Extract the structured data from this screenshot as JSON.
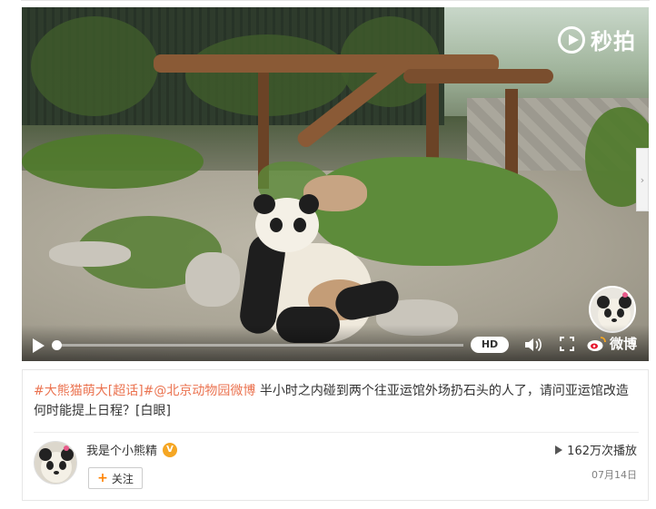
{
  "video": {
    "watermark_top": "秒拍",
    "hd_label": "HD",
    "watermark_bottom": "微博",
    "progress": 0.0,
    "side_arrow": "›"
  },
  "post": {
    "hashtag1": "#大熊猫萌大[超话]#",
    "mention": "@北京动物园微博",
    "body": " 半小时之内碰到两个往亚运馆外场扔石头的人了，请问亚运馆改造何时能提上日程？",
    "emoji": "[白眼]"
  },
  "author": {
    "name": "我是个小熊精",
    "follow_label": "关注",
    "verified_badge": "V"
  },
  "stats": {
    "plays": "162万次播放",
    "date": "07月14日"
  },
  "icons": [
    "play-icon",
    "volume-icon",
    "fullscreen-icon",
    "weibo-icon",
    "miaopai-icon",
    "verified-icon",
    "plus-icon"
  ]
}
